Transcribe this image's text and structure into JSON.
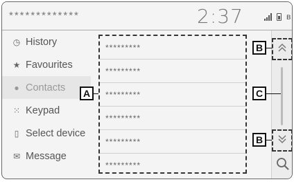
{
  "status_bar": {
    "device_name": "*************",
    "time": "2:37",
    "icons": [
      "signal-icon",
      "battery-icon",
      "bluetooth-icon"
    ]
  },
  "menu": {
    "items": [
      {
        "label": "History",
        "icon": "clock-icon",
        "selected": false
      },
      {
        "label": "Favourites",
        "icon": "star-icon",
        "selected": false
      },
      {
        "label": "Contacts",
        "icon": "person-icon",
        "selected": true
      },
      {
        "label": "Keypad",
        "icon": "keypad-icon",
        "selected": false
      },
      {
        "label": "Select device",
        "icon": "phone-icon",
        "selected": false
      },
      {
        "label": "Message",
        "icon": "envelope-icon",
        "selected": false
      }
    ]
  },
  "list": {
    "items": [
      "*********",
      "*********",
      "*********",
      "*********",
      "*********",
      "*********"
    ]
  },
  "scroll": {
    "up_icon": "double-chevron-up-icon",
    "down_icon": "double-chevron-down-icon",
    "search_icon": "search-icon"
  },
  "callouts": {
    "list": "A",
    "scroll_up": "B",
    "scrollbar": "C",
    "scroll_down": "B"
  },
  "colors": {
    "text": "#555555",
    "selected_text": "#999999",
    "background": "#f4f4f4",
    "callout_border": "#111111"
  }
}
